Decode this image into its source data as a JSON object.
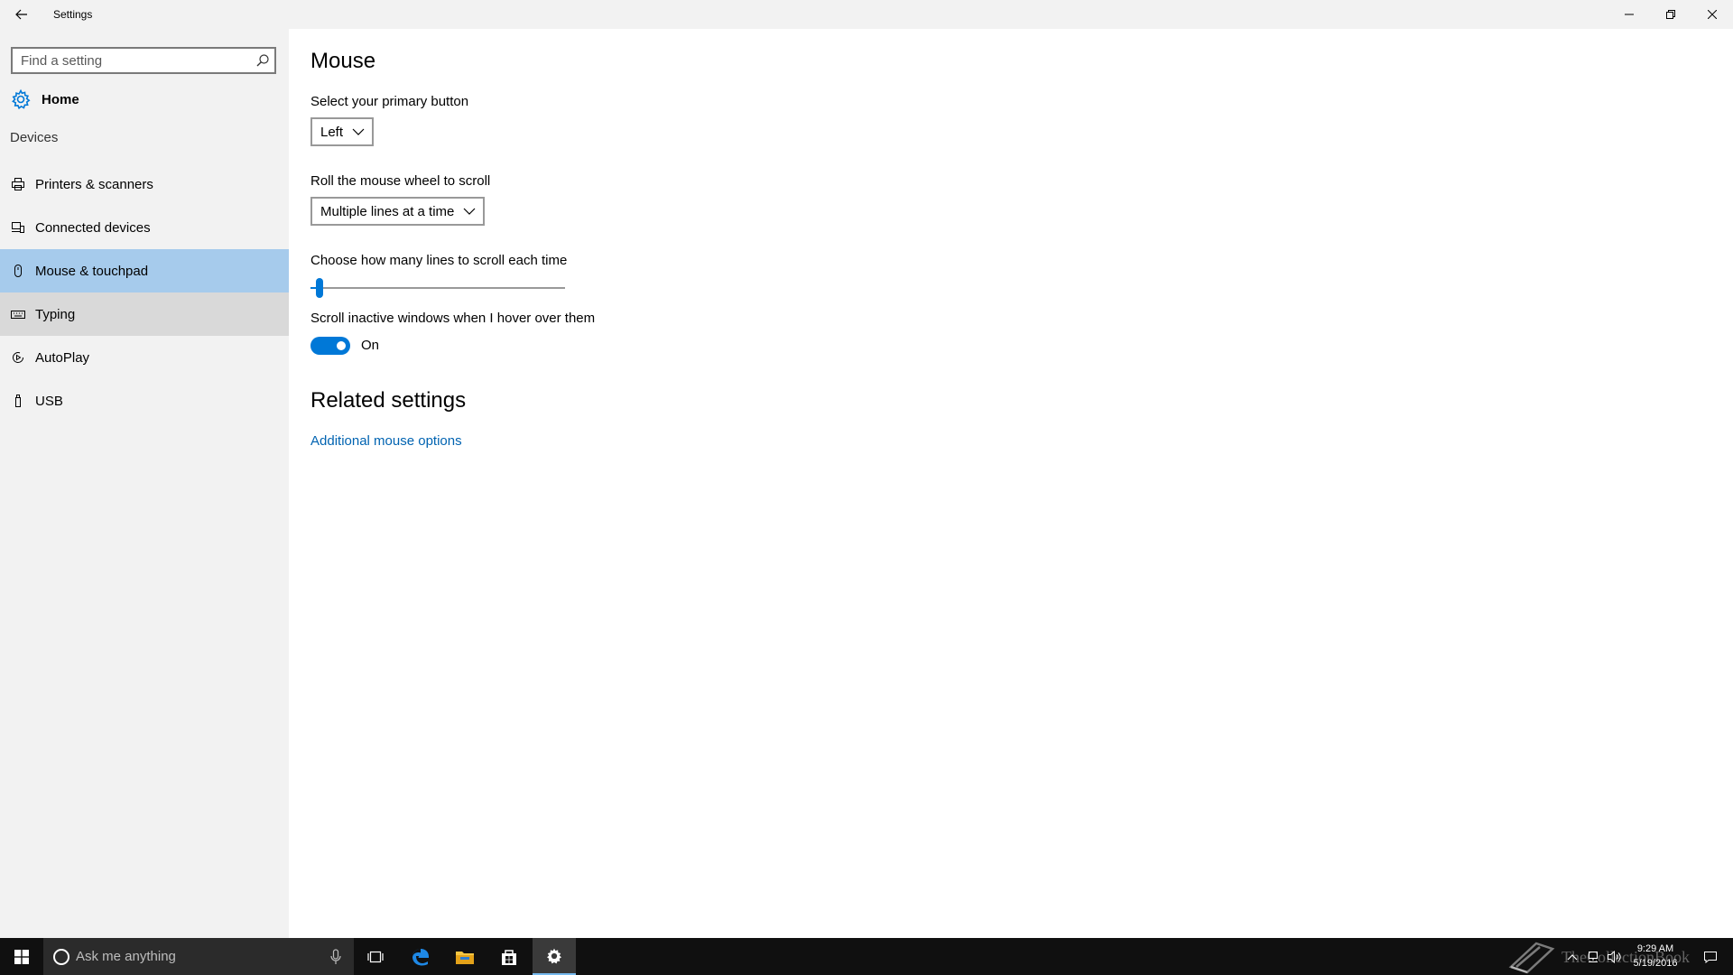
{
  "window": {
    "title": "Settings"
  },
  "sidebar": {
    "search_placeholder": "Find a setting",
    "home_label": "Home",
    "section_label": "Devices",
    "items": [
      {
        "label": "Printers & scanners",
        "icon": "printer-icon"
      },
      {
        "label": "Connected devices",
        "icon": "connected-devices-icon"
      },
      {
        "label": "Mouse & touchpad",
        "icon": "mouse-icon",
        "state": "selected"
      },
      {
        "label": "Typing",
        "icon": "keyboard-icon",
        "state": "hover"
      },
      {
        "label": "AutoPlay",
        "icon": "autoplay-icon"
      },
      {
        "label": "USB",
        "icon": "usb-icon"
      }
    ]
  },
  "main": {
    "heading": "Mouse",
    "primary_button": {
      "label": "Select your primary button",
      "value": "Left"
    },
    "wheel_scroll": {
      "label": "Roll the mouse wheel to scroll",
      "value": "Multiple lines at a time"
    },
    "lines_to_scroll": {
      "label": "Choose how many lines to scroll each time",
      "value": 3,
      "min": 1,
      "max": 100
    },
    "scroll_inactive": {
      "label": "Scroll inactive windows when I hover over them",
      "state_label": "On",
      "on": true
    },
    "related_heading": "Related settings",
    "related_link": "Additional mouse options"
  },
  "taskbar": {
    "search_placeholder": "Ask me anything",
    "time": "9:29 AM",
    "date": "5/19/2016",
    "watermark": "TheCollectionBook"
  },
  "colors": {
    "accent": "#0078d7",
    "selected_bg": "#a6cbec",
    "link": "#0063b1",
    "sidebar_bg": "#f2f2f2",
    "taskbar_bg": "#101010"
  }
}
